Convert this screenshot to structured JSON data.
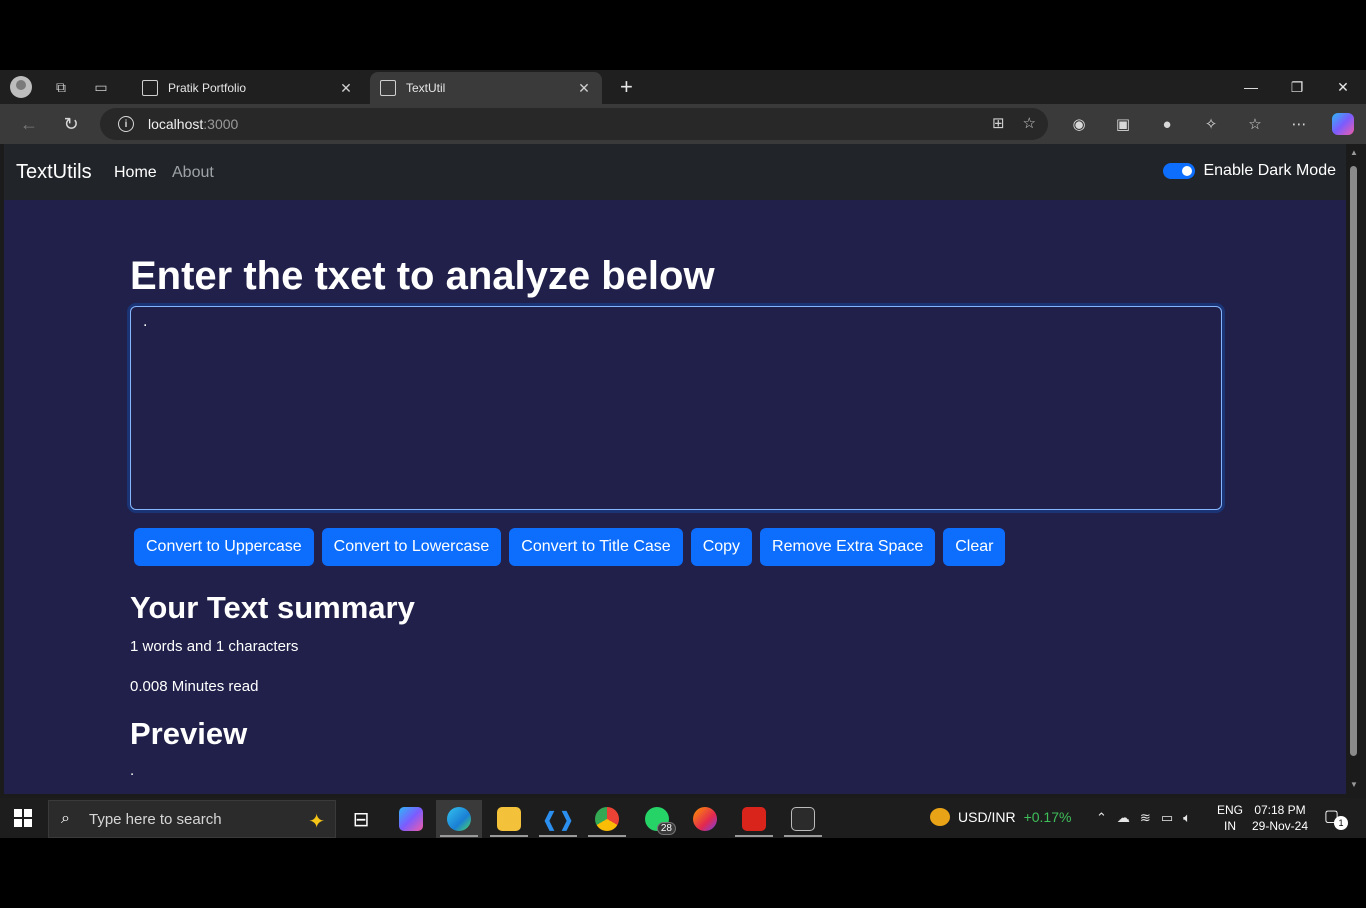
{
  "browser": {
    "tabs": [
      {
        "label": "Pratik Portfolio",
        "active": false
      },
      {
        "label": "TextUtil",
        "active": true
      }
    ],
    "url": {
      "host": "localhost",
      "port": ":3000"
    }
  },
  "app": {
    "brand": "TextUtils",
    "nav": {
      "home": "Home",
      "about": "About"
    },
    "dark_mode_label": "Enable Dark Mode",
    "dark_mode_enabled": true,
    "heading": "Enter the txet to analyze below",
    "textarea_value": ".",
    "buttons": {
      "upper": "Convert to Uppercase",
      "lower": "Convert to Lowercase",
      "title": "Convert to Title Case",
      "copy": "Copy",
      "extra_space": "Remove Extra Space",
      "clear": "Clear"
    },
    "summary": {
      "heading": "Your Text summary",
      "counts": "1 words and 1 characters",
      "read_time": "0.008 Minutes read"
    },
    "preview": {
      "heading": "Preview",
      "text": "."
    },
    "colors": {
      "accent": "#0d6efd",
      "page_bg": "#20204a",
      "navbar_bg": "#212529"
    }
  },
  "taskbar": {
    "search_placeholder": "Type here to search",
    "whatsapp_badge": "28",
    "ticker": {
      "name": "USD/INR",
      "change": "+0.17%"
    },
    "lang": {
      "line1": "ENG",
      "line2": "IN"
    },
    "clock": {
      "time": "07:18 PM",
      "date": "29-Nov-24"
    },
    "notifications": "1"
  }
}
